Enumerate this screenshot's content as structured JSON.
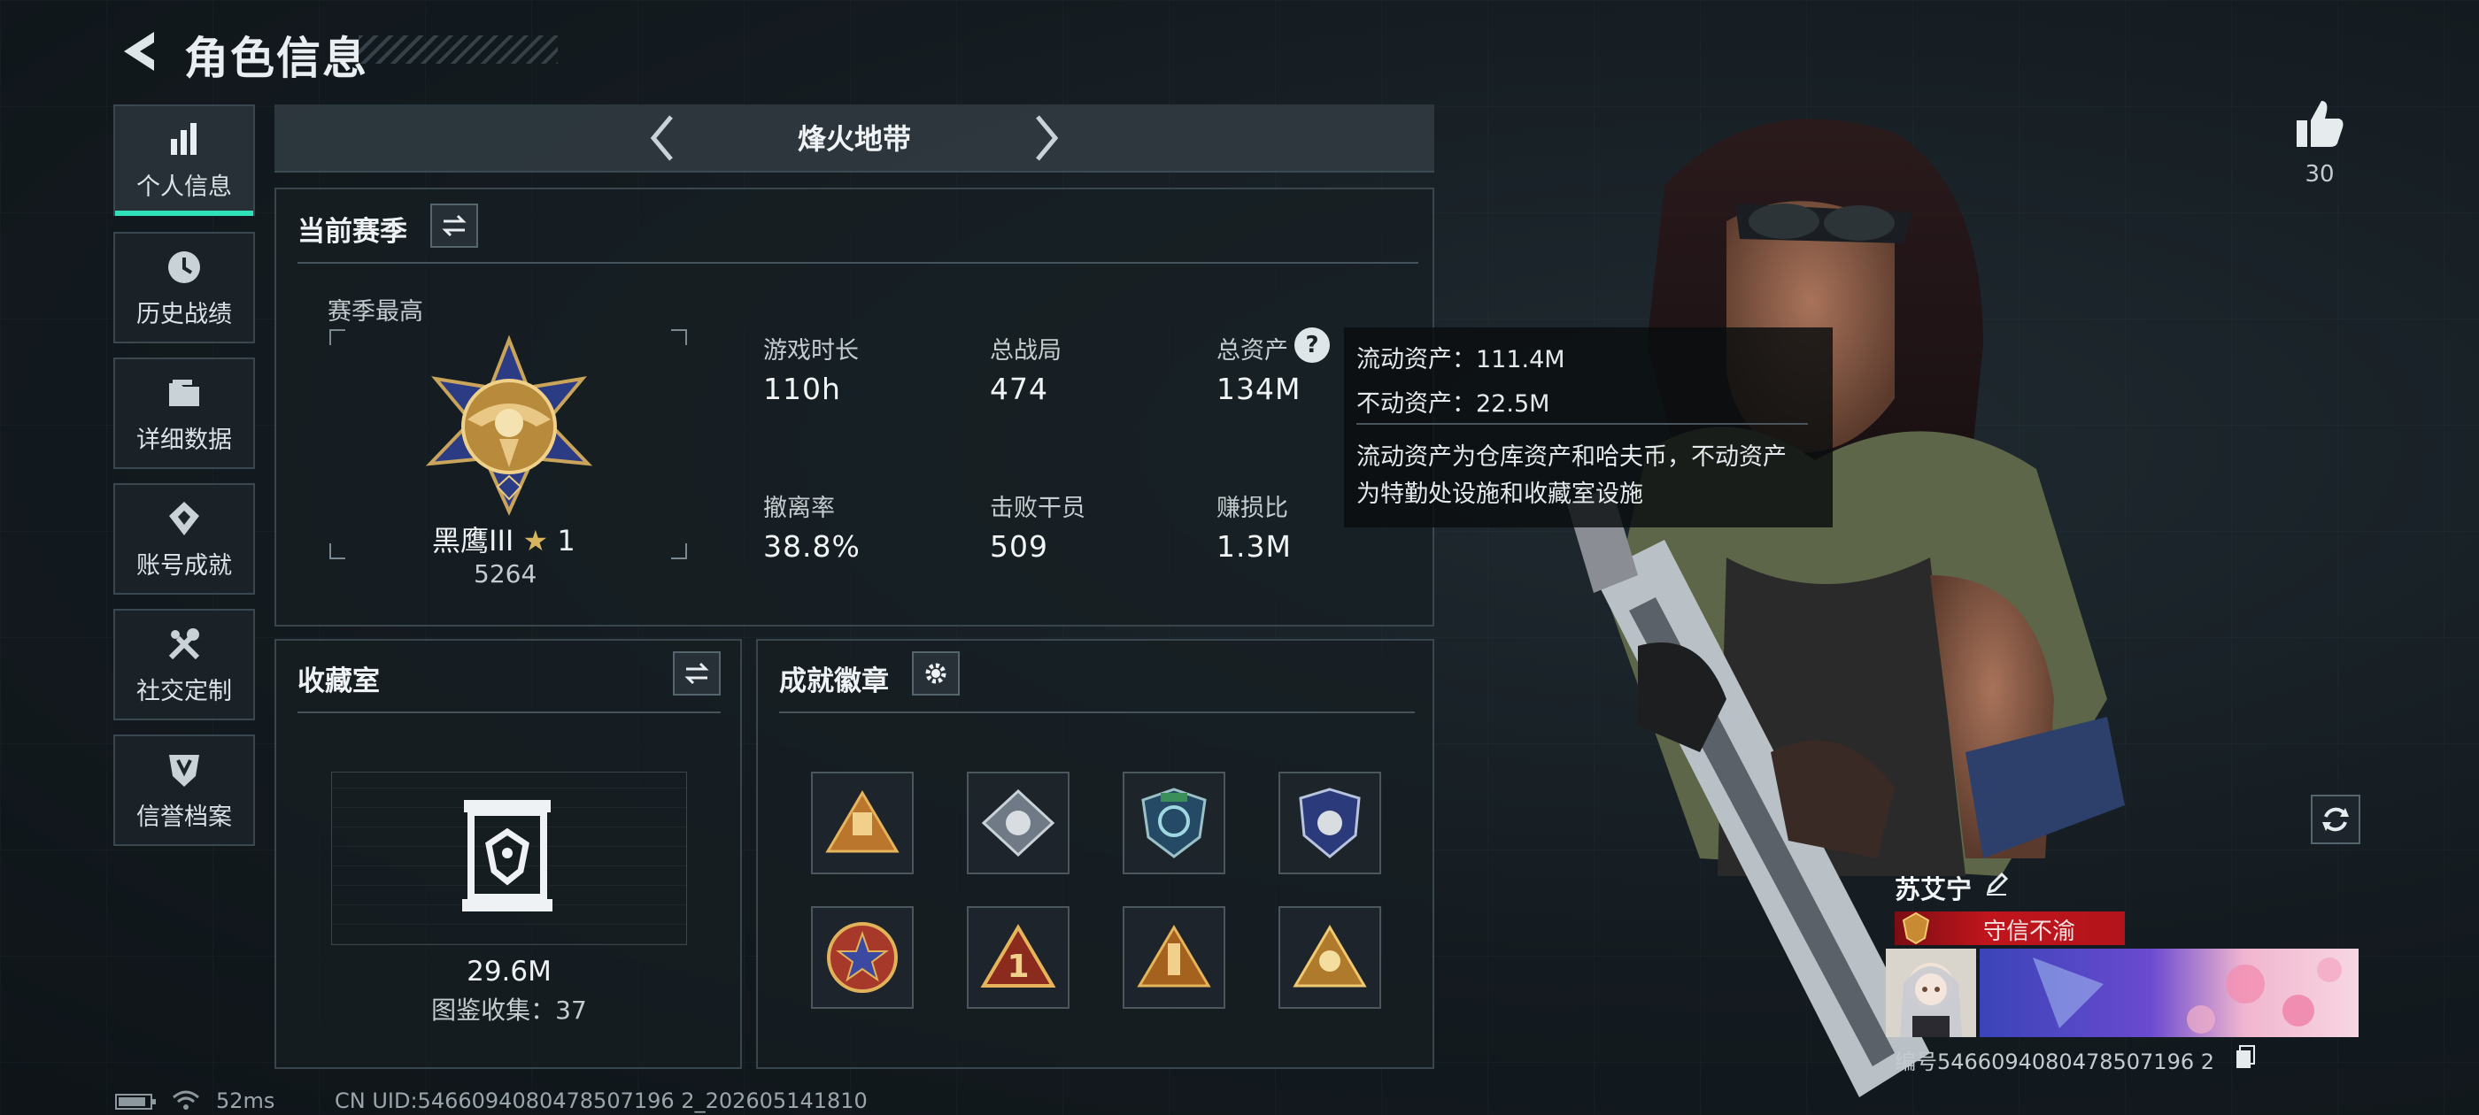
{
  "header": {
    "title": "角色信息"
  },
  "sidebar": {
    "items": [
      {
        "label": "个人信息",
        "icon": "bar-chart-icon",
        "active": true
      },
      {
        "label": "历史战绩",
        "icon": "clock-icon"
      },
      {
        "label": "详细数据",
        "icon": "folder-icon"
      },
      {
        "label": "账号成就",
        "icon": "achievement-icon"
      },
      {
        "label": "社交定制",
        "icon": "tools-icon"
      },
      {
        "label": "信誉档案",
        "icon": "shield-icon"
      }
    ]
  },
  "mode": {
    "title": "烽火地带"
  },
  "season": {
    "title": "当前赛季",
    "best_label": "赛季最高",
    "rank_name": "黑鹰III",
    "rank_star": "1",
    "rank_score": "5264",
    "stats": [
      {
        "label": "游戏时长",
        "value": "110h"
      },
      {
        "label": "总战局",
        "value": "474"
      },
      {
        "label": "总资产",
        "value": "134M"
      },
      {
        "label": "撤离率",
        "value": "38.8%"
      },
      {
        "label": "击败干员",
        "value": "509"
      },
      {
        "label": "赚损比",
        "value": "1.3M"
      }
    ]
  },
  "tooltip": {
    "liquid": "流动资产：111.4M",
    "fixed": "不动资产：22.5M",
    "desc_line1": "流动资产为仓库资产和哈夫币，不动资产",
    "desc_line2": "为特勤处设施和收藏室设施"
  },
  "collection": {
    "title": "收藏室",
    "value": "29.6M",
    "gallery": "图鉴收集：37"
  },
  "achievements": {
    "title": "成就徽章",
    "badges": [
      "badge-1",
      "badge-2",
      "badge-3",
      "badge-4",
      "badge-5",
      "badge-6",
      "badge-7",
      "badge-8"
    ]
  },
  "likes": {
    "count": "30"
  },
  "player": {
    "name": "苏艾宁",
    "tag": "守信不渝",
    "id_text": "编号5466094080478507196 2"
  },
  "status": {
    "ping": "52ms",
    "uid": "CN UID:5466094080478507196 2_202605141810"
  },
  "colors": {
    "accent": "#2fe0b8",
    "tag_red": "#b3141b"
  }
}
